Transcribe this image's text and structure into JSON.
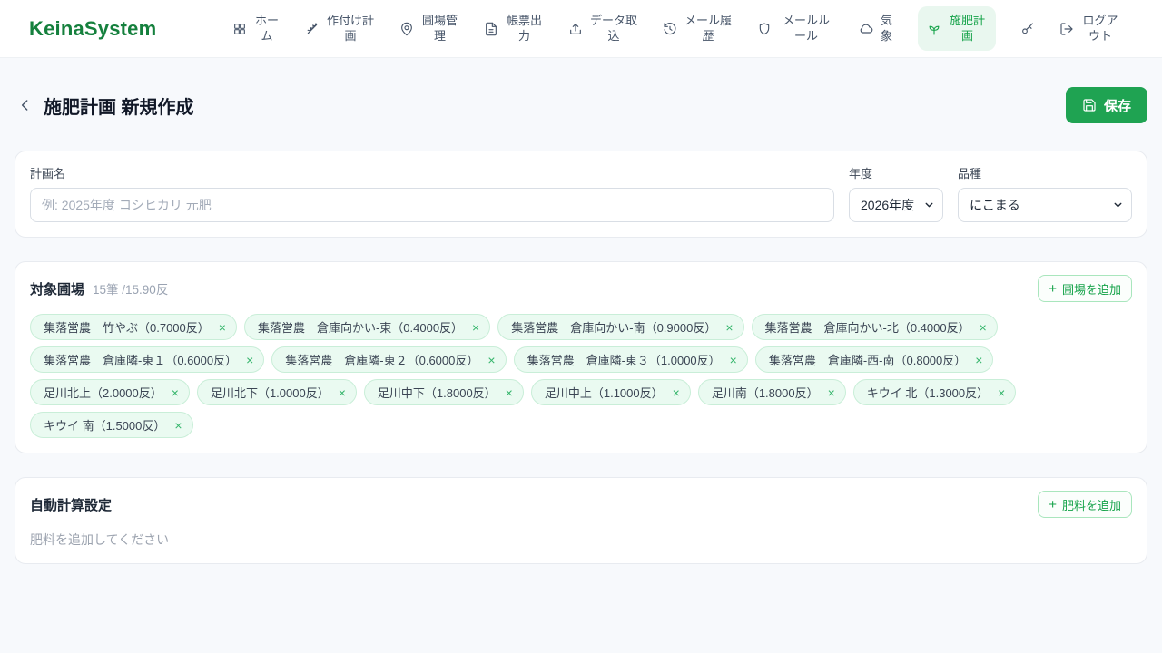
{
  "brand": "KeinaSystem",
  "icons": {
    "plus": "+",
    "close": "×"
  },
  "colors": {
    "primary_green": "#1fa352",
    "logo_green": "#15803d",
    "active_nav_bg": "#e9f7ef",
    "tag_bg": "#eafaf1",
    "tag_border": "#c9eed8"
  },
  "nav": {
    "items": [
      {
        "label": "ホーム",
        "icon": "grid"
      },
      {
        "label": "作付け計画",
        "icon": "wheat"
      },
      {
        "label": "圃場管理",
        "icon": "map-pin"
      },
      {
        "label": "帳票出力",
        "icon": "document"
      },
      {
        "label": "データ取込",
        "icon": "upload"
      },
      {
        "label": "メール履歴",
        "icon": "history"
      },
      {
        "label": "メールルール",
        "icon": "shield"
      },
      {
        "label": "気象",
        "icon": "cloud"
      },
      {
        "label": "施肥計画",
        "icon": "sprout",
        "active": true
      },
      {
        "label": "",
        "icon": "key"
      },
      {
        "label": "ログアウト",
        "icon": "logout"
      }
    ]
  },
  "page": {
    "title": "施肥計画 新規作成",
    "save_label": "保存"
  },
  "form": {
    "plan_name": {
      "label": "計画名",
      "placeholder": "例: 2025年度 コシヒカリ 元肥",
      "value": ""
    },
    "year": {
      "label": "年度",
      "value": "2026年度"
    },
    "variety": {
      "label": "品種",
      "value": "にこまる"
    }
  },
  "fields": {
    "title": "対象圃場",
    "summary": "15筆 /15.90反",
    "add_label": "圃場を追加",
    "tags": [
      "集落営農　竹やぶ（0.7000反）",
      "集落営農　倉庫向かい-東（0.4000反）",
      "集落営農　倉庫向かい-南（0.9000反）",
      "集落営農　倉庫向かい-北（0.4000反）",
      "集落営農　倉庫隣-東１（0.6000反）",
      "集落営農　倉庫隣-東２（0.6000反）",
      "集落営農　倉庫隣-東３（1.0000反）",
      "集落営農　倉庫隣-西-南（0.8000反）",
      "足川北上（2.0000反）",
      "足川北下（1.0000反）",
      "足川中下（1.8000反）",
      "足川中上（1.1000反）",
      "足川南（1.8000反）",
      "キウイ 北（1.3000反）",
      "キウイ 南（1.5000反）"
    ]
  },
  "fertilizer": {
    "title": "自動計算設定",
    "add_label": "肥料を追加",
    "empty_message": "肥料を追加してください"
  }
}
